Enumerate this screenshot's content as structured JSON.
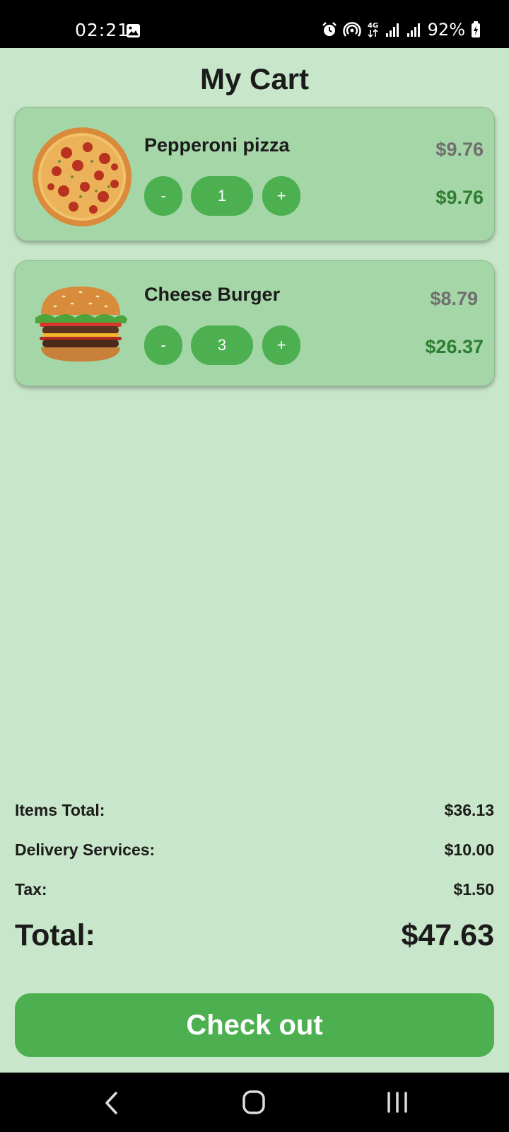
{
  "status_bar": {
    "time": "02:21",
    "battery": "92%",
    "icons": [
      "gallery-icon",
      "alarm-icon",
      "hotspot-icon",
      "4g-icon",
      "signal-icon",
      "signal-icon",
      "battery-charging-icon"
    ]
  },
  "page": {
    "title": "My Cart"
  },
  "cart": {
    "items": [
      {
        "name": "Pepperoni pizza",
        "image": "pepperoni-pizza-image",
        "minus_label": "-",
        "quantity": "1",
        "plus_label": "+",
        "unit_price": "$9.76",
        "line_total": "$9.76"
      },
      {
        "name": "Cheese Burger",
        "image": "cheese-burger-image",
        "minus_label": "-",
        "quantity": "3",
        "plus_label": "+",
        "unit_price": "$8.79",
        "line_total": "$26.37"
      }
    ]
  },
  "summary": {
    "items_total_label": "Items Total:",
    "items_total_value": "$36.13",
    "delivery_label": "Delivery Services:",
    "delivery_value": "$10.00",
    "tax_label": "Tax:",
    "tax_value": "$1.50",
    "total_label": "Total:",
    "total_value": "$47.63"
  },
  "checkout": {
    "label": "Check out"
  },
  "colors": {
    "background": "#c8e6c9",
    "card": "#a5d6a7",
    "accent": "#4caf50",
    "price_green": "#2e7d32",
    "price_grey": "#6f6f6f"
  }
}
